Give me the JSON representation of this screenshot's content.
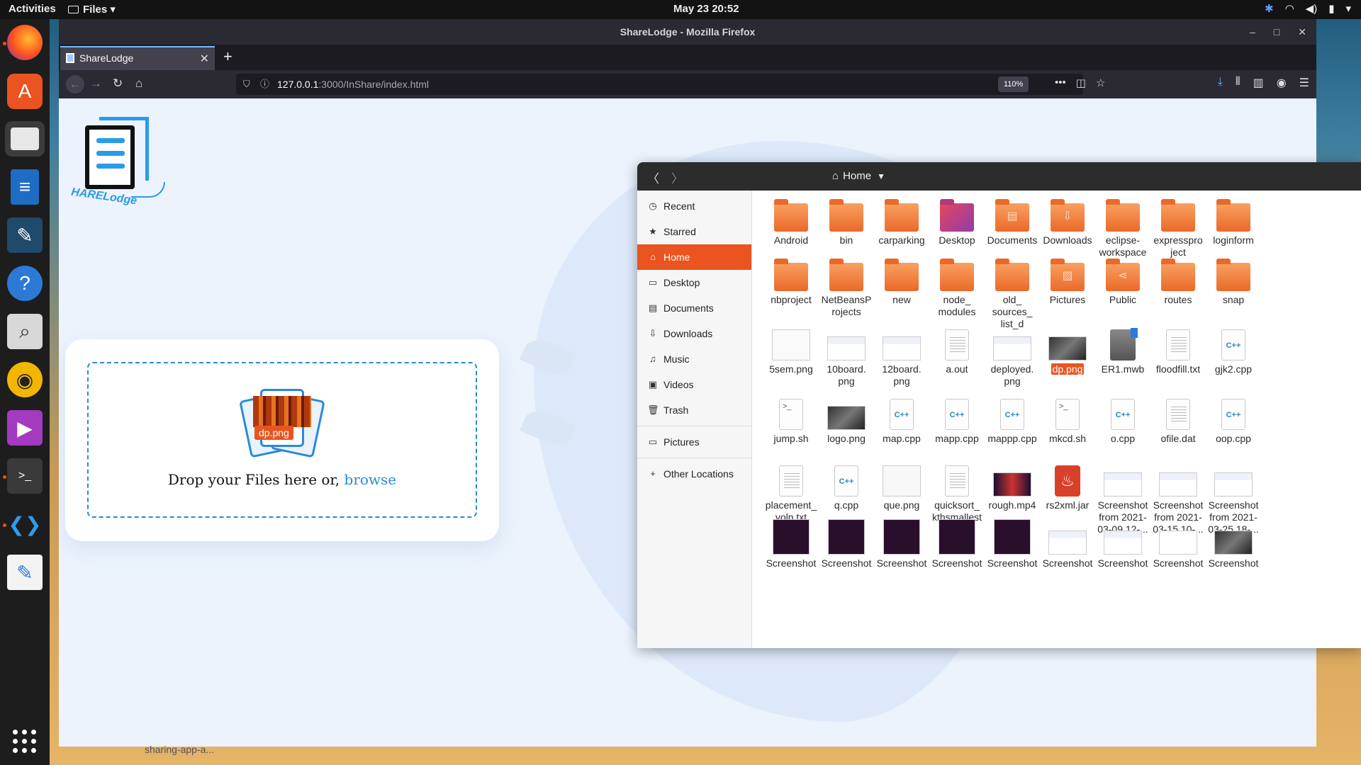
{
  "topbar": {
    "activities": "Activities",
    "app_menu": "Files",
    "clock": "May 23  20:52"
  },
  "dock": {
    "items": [
      "firefox-icon",
      "ubuntu-software-icon",
      "files-icon",
      "libreoffice-writer-icon",
      "mysql-workbench-icon",
      "help-icon",
      "magnifier-icon",
      "rhythmbox-icon",
      "media-player-icon",
      "terminal-icon",
      "vscode-icon",
      "text-editor-icon"
    ]
  },
  "firefox": {
    "window_title": "ShareLodge - Mozilla Firefox",
    "tab_label": "ShareLodge",
    "url_host": "127.0.0.1",
    "url_path": ":3000/InShare/index.html",
    "zoom": "110%"
  },
  "page": {
    "logo_text": "HARELodge",
    "drop_file_label": "dp.png",
    "drop_text": "Drop your Files here or,",
    "browse_label": "browse",
    "status_text": "sharing-app-a..."
  },
  "nautilus": {
    "location": "Home",
    "sidebar": [
      {
        "label": "Recent",
        "icon": "clock-icon"
      },
      {
        "label": "Starred",
        "icon": "star-icon"
      },
      {
        "label": "Home",
        "icon": "home-icon"
      },
      {
        "label": "Desktop",
        "icon": "desktop-icon"
      },
      {
        "label": "Documents",
        "icon": "document-icon"
      },
      {
        "label": "Downloads",
        "icon": "download-icon"
      },
      {
        "label": "Music",
        "icon": "music-icon"
      },
      {
        "label": "Videos",
        "icon": "video-icon"
      },
      {
        "label": "Trash",
        "icon": "trash-icon"
      }
    ],
    "bookmarks": [
      {
        "label": "Pictures"
      }
    ],
    "other": {
      "label": "Other Locations"
    },
    "files": [
      "Android",
      "bin",
      "carparking",
      "Desktop",
      "Documents",
      "Downloads",
      "eclipse-workspace",
      "expressproject",
      "loginform",
      "nbproject",
      "NetBeansProjects",
      "new",
      "node_modules",
      "old_sources_list_d",
      "Pictures",
      "Public",
      "routes",
      "snap",
      "5sem.png",
      "10board.png",
      "12board.png",
      "a.out",
      "deployed.png",
      "dp.png",
      "ER1.mwb",
      "floodfill.txt",
      "gjk2.cpp",
      "jump.sh",
      "logo.png",
      "map.cpp",
      "mapp.cpp",
      "mappp.cpp",
      "mkcd.sh",
      "o.cpp",
      "ofile.dat",
      "oop.cpp",
      "placement_voln.txt",
      "q.cpp",
      "que.png",
      "quicksort_kthsmallest.txt",
      "rough.mp4",
      "rs2xml.jar",
      "Screenshot from 2021-03-09 12-...",
      "Screenshot from 2021-03-15 10-...",
      "Screenshot from 2021-03-25 18-...",
      "Screenshot",
      "Screenshot",
      "Screenshot",
      "Screenshot",
      "Screenshot",
      "Screenshot",
      "Screenshot",
      "Screenshot",
      "Screenshot"
    ],
    "labels_display": [
      "Android",
      "bin",
      "carparking",
      "Desktop",
      "Documents",
      "Downloads",
      "eclipse-\nworkspace",
      "expresspro\nject",
      "loginform",
      "nbproject",
      "NetBeansP\nrojects",
      "new",
      "node_\nmodules",
      "old_\nsources_\nlist_d",
      "Pictures",
      "Public",
      "routes",
      "snap",
      "5sem.png",
      "10board.\npng",
      "12board.\npng",
      "a.out",
      "deployed.\npng",
      "dp.png",
      "ER1.mwb",
      "floodfill.txt",
      "gjk2.cpp",
      "jump.sh",
      "logo.png",
      "map.cpp",
      "mapp.cpp",
      "mappp.cpp",
      "mkcd.sh",
      "o.cpp",
      "ofile.dat",
      "oop.cpp",
      "placement_\nvoln.txt",
      "q.cpp",
      "que.png",
      "quicksort_\nkthsmallest\n.txt",
      "rough.mp4",
      "rs2xml.jar",
      "Screenshot\nfrom 2021-\n03-09 12-...",
      "Screenshot\nfrom 2021-\n03-15 10-...",
      "Screenshot\nfrom 2021-\n03-25 18-...",
      "Screenshot",
      "Screenshot",
      "Screenshot",
      "Screenshot",
      "Screenshot",
      "Screenshot",
      "Screenshot",
      "Screenshot",
      "Screenshot"
    ],
    "kinds": [
      "folder",
      "folder",
      "folder",
      "folder-desktop",
      "folder-documents",
      "folder-downloads",
      "folder",
      "folder",
      "folder",
      "folder",
      "folder",
      "folder",
      "folder",
      "folder",
      "folder-pictures",
      "folder-public",
      "folder",
      "folder",
      "img-white",
      "img-doc",
      "img-doc",
      "text",
      "img-doc",
      "img-dark",
      "mwb",
      "text",
      "cpp",
      "script",
      "img-dark",
      "cpp",
      "cpp",
      "cpp",
      "script",
      "cpp",
      "text",
      "cpp",
      "text",
      "cpp",
      "img-sketch",
      "text",
      "video",
      "jar",
      "img-doc",
      "img-doc",
      "img-doc",
      "img-term",
      "img-term",
      "img-term",
      "img-term",
      "img-term",
      "img-doc",
      "img-doc",
      "img-cal",
      "img-dark"
    ],
    "selected": "dp.png"
  }
}
